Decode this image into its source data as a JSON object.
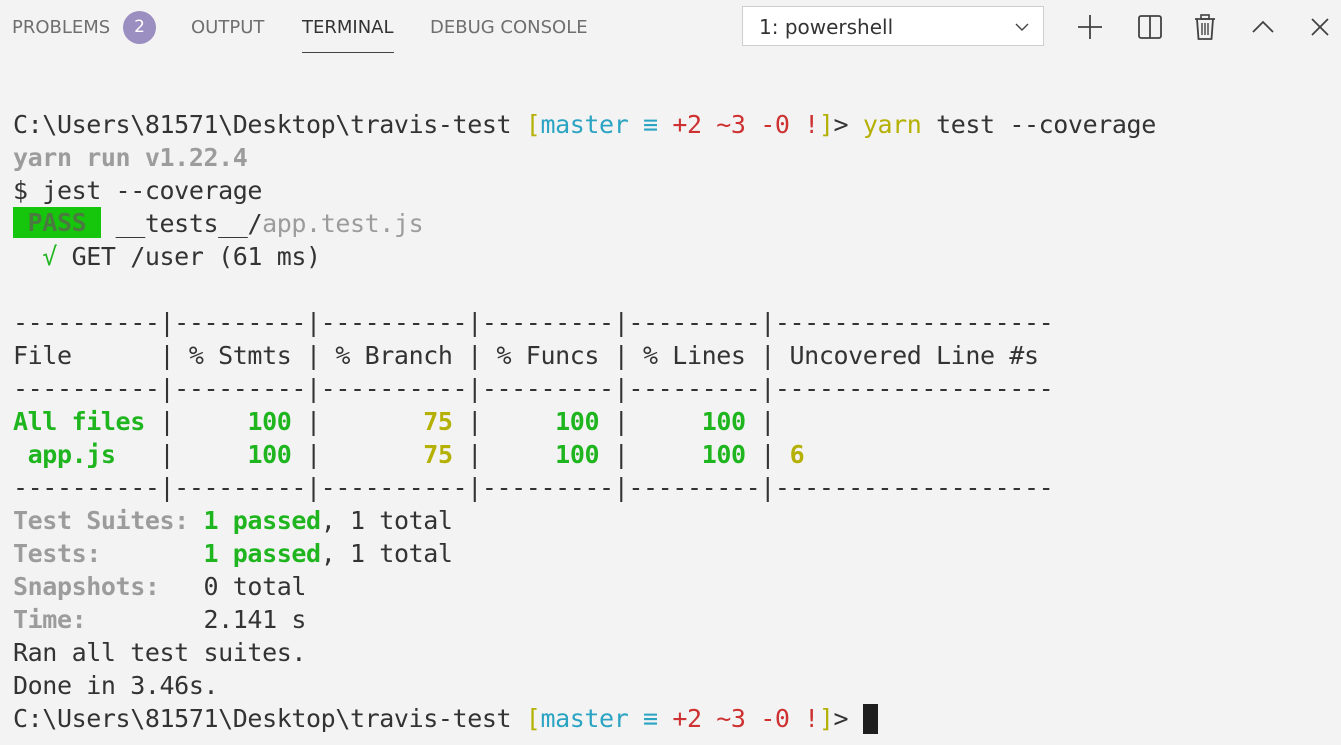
{
  "tabs": {
    "problems": "PROBLEMS",
    "problems_count": "2",
    "output": "OUTPUT",
    "terminal": "TERMINAL",
    "debug_console": "DEBUG CONSOLE"
  },
  "terminal_select": {
    "value": "1: powershell"
  },
  "actions": {
    "new_terminal": "plus-icon",
    "split_terminal": "split-icon",
    "kill_terminal": "trash-icon",
    "maximize_panel": "chevron-up-icon",
    "close_panel": "close-icon"
  },
  "colors": {
    "background": "#f3f3f3",
    "git_branch": "#2ba3c2",
    "git_changes": "#cd3131",
    "yarn": "#b5b004",
    "pass_badge": "#16c60c",
    "success": "#1fb51f",
    "badge": "#9a8fc0"
  },
  "terminal": {
    "prompt_path": "C:\\Users\\81571\\Desktop\\travis-test ",
    "prompt_open_bracket": "[",
    "prompt_branch": "master ≡",
    "prompt_changes": " +2 ~3 -0 !",
    "prompt_close_bracket": "]",
    "prompt_end": "> ",
    "cmd_yarn": "yarn",
    "cmd_args": " test --coverage",
    "yarn_version": "yarn run v1.22.4",
    "jest_cmd": "$ jest --coverage",
    "pass_label": " PASS ",
    "test_dir": "__tests__/",
    "test_file": "app.test.js",
    "check_mark": "  √",
    "test_name": " GET /user (61 ms)",
    "table_sep": "----------|---------|----------|---------|---------|-------------------",
    "table_header": "File      | % Stmts | % Branch | % Funcs | % Lines | Uncovered Line #s",
    "row_all": {
      "file": "All files",
      "stmts": "100",
      "branch": "75",
      "funcs": "100",
      "lines": "100",
      "uncovered": ""
    },
    "row_app": {
      "file": "app.js",
      "stmts": "100",
      "branch": "75",
      "funcs": "100",
      "lines": "100",
      "uncovered": "6"
    },
    "suites_label": "Test Suites: ",
    "suites_passed": "1 passed",
    "suites_total": ", 1 total",
    "tests_label": "Tests:       ",
    "tests_passed": "1 passed",
    "tests_total": ", 1 total",
    "snapshots_label": "Snapshots:   ",
    "snapshots_value": "0 total",
    "time_label": "Time:        ",
    "time_value": "2.141 s",
    "ran_all": "Ran all test suites.",
    "done": "Done in 3.46s."
  }
}
